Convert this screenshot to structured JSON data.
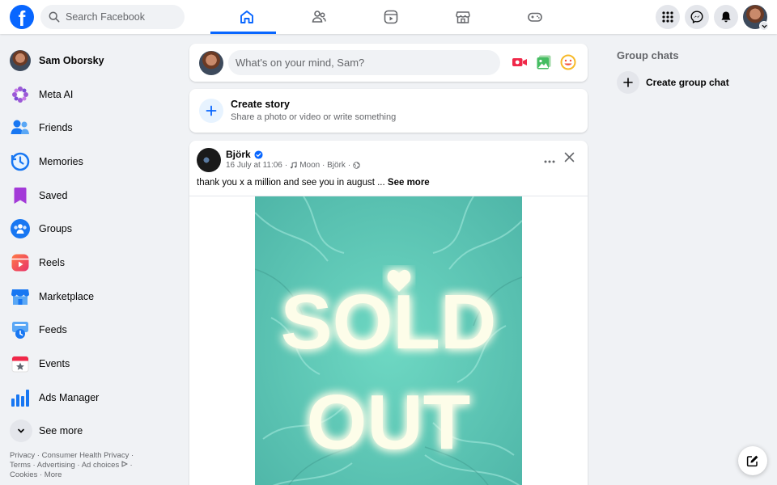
{
  "header": {
    "search_placeholder": "Search Facebook",
    "nav_tabs": [
      "home",
      "friends",
      "video",
      "marketplace",
      "gaming"
    ],
    "active_tab": "home",
    "brand_color": "#0866ff"
  },
  "sidebar": {
    "items": [
      {
        "label": "Sam Oborsky",
        "icon": "profile-avatar"
      },
      {
        "label": "Meta AI",
        "icon": "meta-ai-icon"
      },
      {
        "label": "Friends",
        "icon": "friends-icon"
      },
      {
        "label": "Memories",
        "icon": "memories-icon"
      },
      {
        "label": "Saved",
        "icon": "saved-icon"
      },
      {
        "label": "Groups",
        "icon": "groups-icon"
      },
      {
        "label": "Reels",
        "icon": "reels-icon"
      },
      {
        "label": "Marketplace",
        "icon": "marketplace-icon"
      },
      {
        "label": "Feeds",
        "icon": "feeds-icon"
      },
      {
        "label": "Events",
        "icon": "events-icon"
      },
      {
        "label": "Ads Manager",
        "icon": "ads-manager-icon"
      }
    ],
    "see_more": "See more",
    "footer": {
      "privacy": "Privacy",
      "consumer_health": "Consumer Health Privacy",
      "terms": "Terms",
      "advertising": "Advertising",
      "ad_choices": "Ad choices",
      "cookies": "Cookies",
      "more": "More",
      "sep": " · "
    }
  },
  "composer": {
    "placeholder": "What's on your mind, Sam?"
  },
  "story": {
    "title": "Create story",
    "subtitle": "Share a photo or video or write something"
  },
  "post": {
    "author": "Björk",
    "date": "16 July at 11:06",
    "music": "Moon · Björk",
    "caption": "thank you x a million and see you in august ...",
    "see_more": "See more",
    "image_text_line1": "SOLD",
    "image_text_line2": "OUT"
  },
  "right": {
    "group_chats_title": "Group chats",
    "create_group_chat": "Create group chat"
  }
}
